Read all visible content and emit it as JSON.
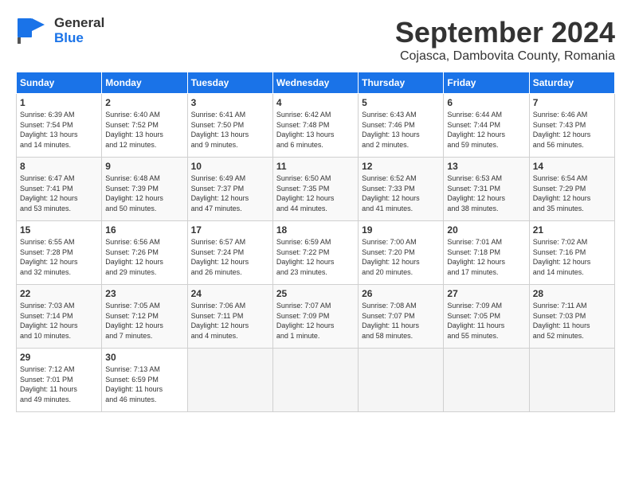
{
  "header": {
    "logo_general": "General",
    "logo_blue": "Blue",
    "month": "September 2024",
    "location": "Cojasca, Dambovita County, Romania"
  },
  "days_of_week": [
    "Sunday",
    "Monday",
    "Tuesday",
    "Wednesday",
    "Thursday",
    "Friday",
    "Saturday"
  ],
  "weeks": [
    [
      {
        "day": "1",
        "info": "Sunrise: 6:39 AM\nSunset: 7:54 PM\nDaylight: 13 hours\nand 14 minutes."
      },
      {
        "day": "2",
        "info": "Sunrise: 6:40 AM\nSunset: 7:52 PM\nDaylight: 13 hours\nand 12 minutes."
      },
      {
        "day": "3",
        "info": "Sunrise: 6:41 AM\nSunset: 7:50 PM\nDaylight: 13 hours\nand 9 minutes."
      },
      {
        "day": "4",
        "info": "Sunrise: 6:42 AM\nSunset: 7:48 PM\nDaylight: 13 hours\nand 6 minutes."
      },
      {
        "day": "5",
        "info": "Sunrise: 6:43 AM\nSunset: 7:46 PM\nDaylight: 13 hours\nand 2 minutes."
      },
      {
        "day": "6",
        "info": "Sunrise: 6:44 AM\nSunset: 7:44 PM\nDaylight: 12 hours\nand 59 minutes."
      },
      {
        "day": "7",
        "info": "Sunrise: 6:46 AM\nSunset: 7:43 PM\nDaylight: 12 hours\nand 56 minutes."
      }
    ],
    [
      {
        "day": "8",
        "info": "Sunrise: 6:47 AM\nSunset: 7:41 PM\nDaylight: 12 hours\nand 53 minutes."
      },
      {
        "day": "9",
        "info": "Sunrise: 6:48 AM\nSunset: 7:39 PM\nDaylight: 12 hours\nand 50 minutes."
      },
      {
        "day": "10",
        "info": "Sunrise: 6:49 AM\nSunset: 7:37 PM\nDaylight: 12 hours\nand 47 minutes."
      },
      {
        "day": "11",
        "info": "Sunrise: 6:50 AM\nSunset: 7:35 PM\nDaylight: 12 hours\nand 44 minutes."
      },
      {
        "day": "12",
        "info": "Sunrise: 6:52 AM\nSunset: 7:33 PM\nDaylight: 12 hours\nand 41 minutes."
      },
      {
        "day": "13",
        "info": "Sunrise: 6:53 AM\nSunset: 7:31 PM\nDaylight: 12 hours\nand 38 minutes."
      },
      {
        "day": "14",
        "info": "Sunrise: 6:54 AM\nSunset: 7:29 PM\nDaylight: 12 hours\nand 35 minutes."
      }
    ],
    [
      {
        "day": "15",
        "info": "Sunrise: 6:55 AM\nSunset: 7:28 PM\nDaylight: 12 hours\nand 32 minutes."
      },
      {
        "day": "16",
        "info": "Sunrise: 6:56 AM\nSunset: 7:26 PM\nDaylight: 12 hours\nand 29 minutes."
      },
      {
        "day": "17",
        "info": "Sunrise: 6:57 AM\nSunset: 7:24 PM\nDaylight: 12 hours\nand 26 minutes."
      },
      {
        "day": "18",
        "info": "Sunrise: 6:59 AM\nSunset: 7:22 PM\nDaylight: 12 hours\nand 23 minutes."
      },
      {
        "day": "19",
        "info": "Sunrise: 7:00 AM\nSunset: 7:20 PM\nDaylight: 12 hours\nand 20 minutes."
      },
      {
        "day": "20",
        "info": "Sunrise: 7:01 AM\nSunset: 7:18 PM\nDaylight: 12 hours\nand 17 minutes."
      },
      {
        "day": "21",
        "info": "Sunrise: 7:02 AM\nSunset: 7:16 PM\nDaylight: 12 hours\nand 14 minutes."
      }
    ],
    [
      {
        "day": "22",
        "info": "Sunrise: 7:03 AM\nSunset: 7:14 PM\nDaylight: 12 hours\nand 10 minutes."
      },
      {
        "day": "23",
        "info": "Sunrise: 7:05 AM\nSunset: 7:12 PM\nDaylight: 12 hours\nand 7 minutes."
      },
      {
        "day": "24",
        "info": "Sunrise: 7:06 AM\nSunset: 7:11 PM\nDaylight: 12 hours\nand 4 minutes."
      },
      {
        "day": "25",
        "info": "Sunrise: 7:07 AM\nSunset: 7:09 PM\nDaylight: 12 hours\nand 1 minute."
      },
      {
        "day": "26",
        "info": "Sunrise: 7:08 AM\nSunset: 7:07 PM\nDaylight: 11 hours\nand 58 minutes."
      },
      {
        "day": "27",
        "info": "Sunrise: 7:09 AM\nSunset: 7:05 PM\nDaylight: 11 hours\nand 55 minutes."
      },
      {
        "day": "28",
        "info": "Sunrise: 7:11 AM\nSunset: 7:03 PM\nDaylight: 11 hours\nand 52 minutes."
      }
    ],
    [
      {
        "day": "29",
        "info": "Sunrise: 7:12 AM\nSunset: 7:01 PM\nDaylight: 11 hours\nand 49 minutes."
      },
      {
        "day": "30",
        "info": "Sunrise: 7:13 AM\nSunset: 6:59 PM\nDaylight: 11 hours\nand 46 minutes."
      },
      null,
      null,
      null,
      null,
      null
    ]
  ]
}
